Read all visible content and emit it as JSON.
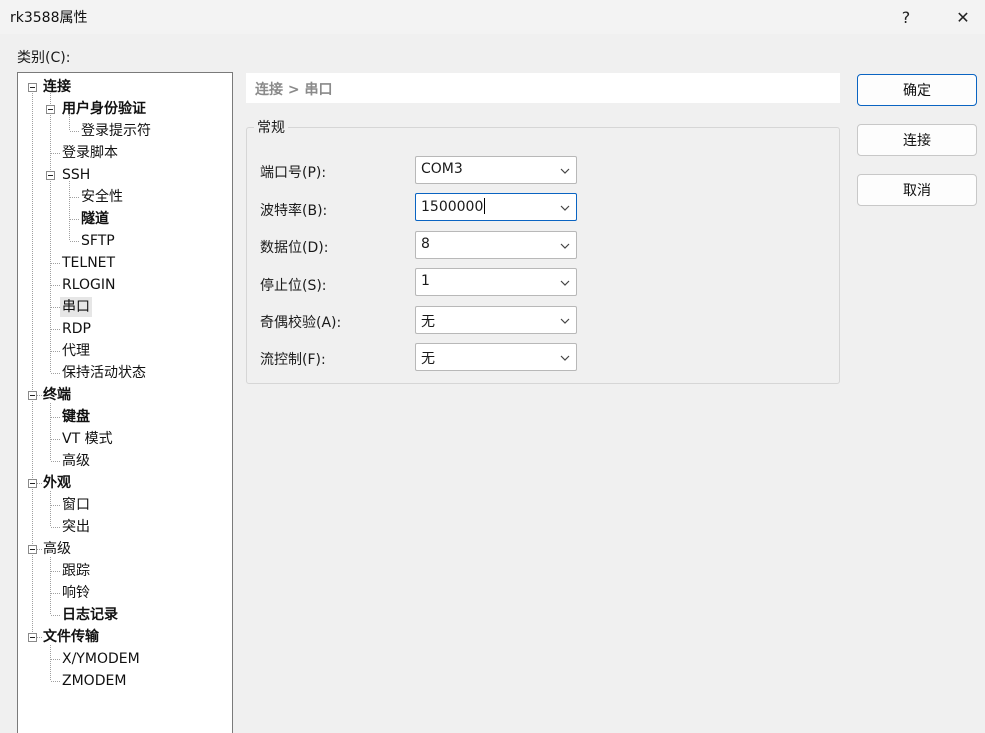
{
  "window": {
    "title": "rk3588属性",
    "help_label": "?",
    "close_label": "✕"
  },
  "category_label": "类别(C):",
  "tree": {
    "connection": "连接",
    "user_auth": "用户身份验证",
    "login_prompt": "登录提示符",
    "login_script": "登录脚本",
    "ssh": "SSH",
    "security": "安全性",
    "tunnel": "隧道",
    "sftp": "SFTP",
    "telnet": "TELNET",
    "rlogin": "RLOGIN",
    "serial": "串口",
    "rdp": "RDP",
    "proxy": "代理",
    "keepalive": "保持活动状态",
    "terminal": "终端",
    "keyboard": "键盘",
    "vt_mode": "VT 模式",
    "terminal_advanced": "高级",
    "appearance": "外观",
    "window": "窗口",
    "highlight": "突出",
    "advanced": "高级",
    "trace": "跟踪",
    "bell": "响铃",
    "logging": "日志记录",
    "file_transfer": "文件传输",
    "xymodem": "X/YMODEM",
    "zmodem": "ZMODEM"
  },
  "breadcrumb": "连接 > 串口",
  "group_title": "常规",
  "fields": {
    "port_label": "端口号(P):",
    "port_value": "COM3",
    "baud_label": "波特率(B):",
    "baud_value": "1500000",
    "databits_label": "数据位(D):",
    "databits_value": "8",
    "stopbits_label": "停止位(S):",
    "stopbits_value": "1",
    "parity_label": "奇偶校验(A):",
    "parity_value": "无",
    "flow_label": "流控制(F):",
    "flow_value": "无"
  },
  "buttons": {
    "ok": "确定",
    "connect": "连接",
    "cancel": "取消"
  },
  "colors": {
    "accent": "#0a64c2",
    "background": "#f0f0f0"
  }
}
